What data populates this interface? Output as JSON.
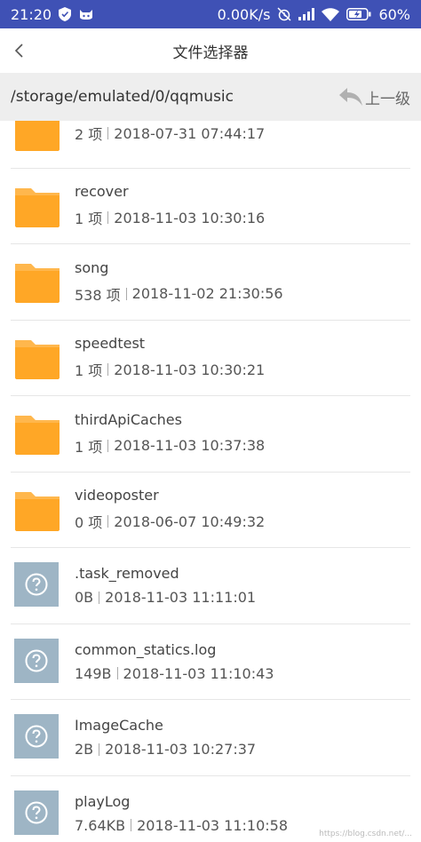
{
  "status_bar": {
    "time": "21:20",
    "network_speed": "0.00K/s",
    "battery": "60%",
    "icons": [
      "shield-icon",
      "cat-icon",
      "alarm-off-icon",
      "signal-icon",
      "wifi-icon",
      "battery-icon"
    ]
  },
  "header": {
    "title": "文件选择器"
  },
  "path_bar": {
    "path": "/storage/emulated/0/qqmusic",
    "up_label": "上一级"
  },
  "colors": {
    "status_bar": "#3f51b5",
    "folder": "#ffb74d",
    "unknown_file": "#9eb5c5"
  },
  "files": [
    {
      "name": "",
      "size": "2 项",
      "date": "2018-07-31 07:44:17",
      "type": "folder"
    },
    {
      "name": "recover",
      "size": "1 项",
      "date": "2018-11-03 10:30:16",
      "type": "folder"
    },
    {
      "name": "song",
      "size": "538 项",
      "date": "2018-11-02 21:30:56",
      "type": "folder"
    },
    {
      "name": "speedtest",
      "size": "1 项",
      "date": "2018-11-03 10:30:21",
      "type": "folder"
    },
    {
      "name": "thirdApiCaches",
      "size": "1 项",
      "date": "2018-11-03 10:37:38",
      "type": "folder"
    },
    {
      "name": "videoposter",
      "size": "0 项",
      "date": "2018-06-07 10:49:32",
      "type": "folder"
    },
    {
      "name": ".task_removed",
      "size": "0B",
      "date": "2018-11-03 11:11:01",
      "type": "unknown"
    },
    {
      "name": "common_statics.log",
      "size": "149B",
      "date": "2018-11-03 11:10:43",
      "type": "unknown"
    },
    {
      "name": "ImageCache",
      "size": "2B",
      "date": "2018-11-03 10:27:37",
      "type": "unknown"
    },
    {
      "name": "playLog",
      "size": "7.64KB",
      "date": "2018-11-03 11:10:58",
      "type": "unknown"
    }
  ]
}
